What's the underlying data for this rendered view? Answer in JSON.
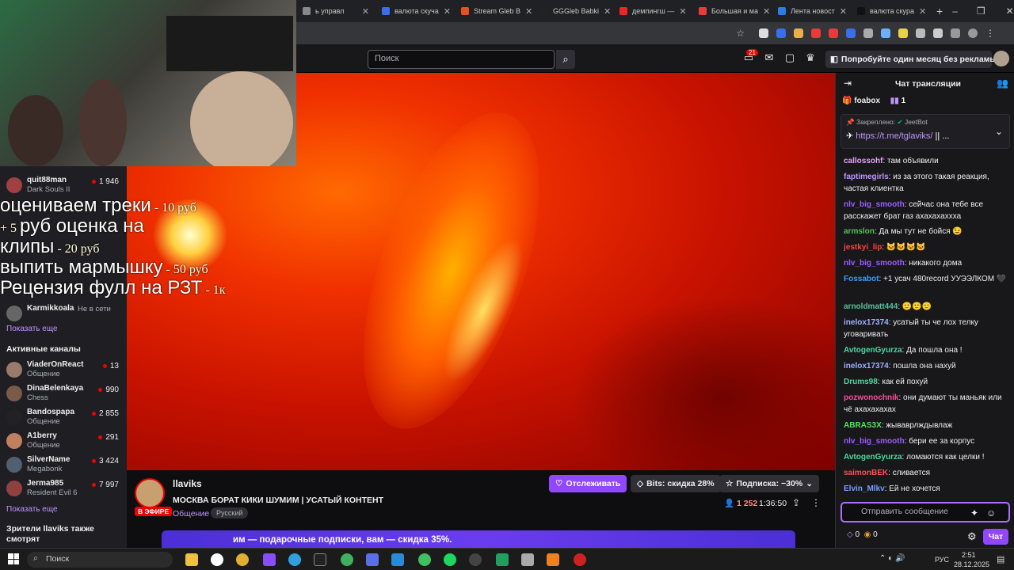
{
  "browser": {
    "tabs": [
      {
        "title": "ь управл",
        "color": "#888888"
      },
      {
        "title": "валюта скуча",
        "color": "#3b6ee8"
      },
      {
        "title": "Stream Gleb B",
        "color": "#e8501e"
      },
      {
        "title": "GGGleb Babki",
        "color": "#222222"
      },
      {
        "title": "демпингш —",
        "color": "#e82828"
      },
      {
        "title": "Большая и ма",
        "color": "#e83c3c"
      },
      {
        "title": "Лента новост",
        "color": "#2a7de1"
      },
      {
        "title": "валюта скура",
        "color": "#111111"
      }
    ],
    "new_tab": "+"
  },
  "topnav": {
    "search_placeholder": "Поиск",
    "notifications_count": "21",
    "promo": "Попробуйте один месяц без рекламы"
  },
  "sidebar": {
    "top_channels": [
      {
        "name": "quit88man",
        "game": "Dark Souls II",
        "viewers": "1 946",
        "color": "#a04040"
      },
      {
        "name": "Karmikkoala",
        "game": "",
        "viewers": "Не в сети",
        "color": "#666666"
      }
    ],
    "show_more": "Показать еще",
    "active_title": "Активные каналы",
    "active_channels": [
      {
        "name": "ViaderOnReact",
        "game": "Общение",
        "viewers": "13",
        "color": "#9a7a6a"
      },
      {
        "name": "DinaBelenkaya",
        "game": "Chess",
        "viewers": "990",
        "color": "#7a5a4a"
      },
      {
        "name": "Bandospapa",
        "game": "Общение",
        "viewers": "2 855",
        "color": "#222222"
      },
      {
        "name": "A1berry",
        "game": "Общение",
        "viewers": "291",
        "color": "#c08060"
      },
      {
        "name": "SilverName",
        "game": "Megabonk",
        "viewers": "3 424",
        "color": "#506070"
      },
      {
        "name": "Jerma985",
        "game": "Resident Evil 6",
        "viewers": "7 997",
        "color": "#904040"
      }
    ],
    "show_more_2": "Показать еще",
    "also_watch": "Зрители llaviks также смотрят"
  },
  "overlay_lines": [
    {
      "main": "оцениваем треки",
      "price": " - 10 руб"
    },
    {
      "main": "руб оценка на",
      "price": "+ 5 "
    },
    {
      "main": "клипы",
      "price": " - 20 руб"
    },
    {
      "main": "выпить мармышку",
      "price": " - 50 руб"
    },
    {
      "main": "Рецензия фулл на РЗТ",
      "price": " - 1к"
    }
  ],
  "stream": {
    "live_label": "В ЭФИРЕ",
    "streamer": "llaviks",
    "title": "МОСКВА БОРАТ КИКИ ШУМИМ | УСАТЫЙ КОНТЕНТ",
    "category": "Общение",
    "tag": "Русский",
    "follow": "Отслеживать",
    "bits": "Bits: скидка 28%",
    "subscribe": "Подписка: −30%",
    "viewers": "1 252",
    "uptime": "1:36:50",
    "banner": "им — подарочные подписки, вам — скидка 35%."
  },
  "chat": {
    "title": "Чат трансляции",
    "leader": "foabox",
    "leader_count": "1",
    "pinned_label": "Закреплено:",
    "pinned_by": "JeetBot",
    "pinned_link": "https://t.me/tglaviks/",
    "messages": [
      {
        "user": "callossohf",
        "color": "#e8a0ff",
        "text": "там объявили"
      },
      {
        "user": "faptimegirls",
        "color": "#bf94ff",
        "text": "из за этого такая реакция, частая клиентка"
      },
      {
        "user": "nlv_big_smooth",
        "color": "#9d5cff",
        "text": "сейчас она тебе все расскажет брат газ ахахахаххха"
      },
      {
        "user": "armslon",
        "color": "#56c156",
        "text": "Да мы тут не бойся 😉"
      },
      {
        "user": "jestkyi_lip",
        "color": "#ff4040",
        "text": "🐱🐱🐱🐱"
      },
      {
        "user": "nlv_big_smooth",
        "color": "#9d5cff",
        "text": "никакого дома"
      },
      {
        "user": "Fossabot",
        "color": "#3c9cff",
        "text": "+1 усач 480record УУЭЭЛКОМ 🖤"
      },
      {
        "user": "arnoldmatt444",
        "color": "#56c1a0",
        "text": "🙂🙂🙂"
      },
      {
        "user": "inelox17374",
        "color": "#a0b0ff",
        "text": "усатый ты че лох телку уговаривать"
      },
      {
        "user": "AvtogenGyurza",
        "color": "#4cd9a0",
        "text": "Да пошла она !"
      },
      {
        "user": "inelox17374",
        "color": "#a0b0ff",
        "text": "пошла она нахуй"
      },
      {
        "user": "Drums98",
        "color": "#4cd9a0",
        "text": "как ей похуй"
      },
      {
        "user": "pozwonochnik",
        "color": "#ff4aa0",
        "text": "они думают ты маньяк или чё ахахахахах"
      },
      {
        "user": "ABRAS3X",
        "color": "#56e060",
        "text": "жываврлждывлаж"
      },
      {
        "user": "nlv_big_smooth",
        "color": "#9d5cff",
        "text": "бери ее за корпус"
      },
      {
        "user": "AvtogenGyurza",
        "color": "#4cd9a0",
        "text": "ломаются как целки !"
      },
      {
        "user": "saimonBEK",
        "color": "#ff5050",
        "text": "сливается"
      },
      {
        "user": "Elvin_Mlkv",
        "color": "#7a9cff",
        "text": "Ей не хочется"
      }
    ],
    "input_placeholder": "Отправить сообщение",
    "points_a": "0",
    "points_b": "0",
    "send": "Чат"
  },
  "taskbar": {
    "search_label": "Поиск",
    "lang": "РУС",
    "time": "2:51",
    "date": "28.12.2025"
  }
}
